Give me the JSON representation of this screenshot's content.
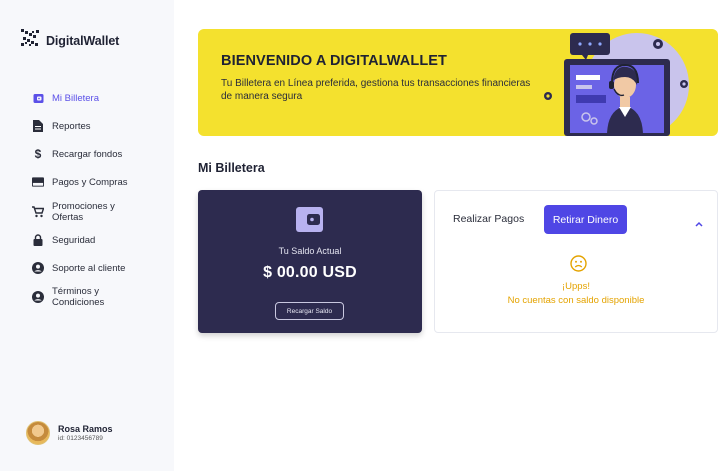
{
  "brand": {
    "name": "DigitalWallet"
  },
  "sidebar": {
    "items": [
      {
        "label": "Mi Billetera",
        "icon": "wallet-icon",
        "active": true
      },
      {
        "label": "Reportes",
        "icon": "report-icon"
      },
      {
        "label": "Recargar fondos",
        "icon": "dollar-icon"
      },
      {
        "label": "Pagos y Compras",
        "icon": "credit-card-icon"
      },
      {
        "label": "Promociones y Ofertas",
        "icon": "cart-icon"
      },
      {
        "label": "Seguridad",
        "icon": "lock-icon"
      },
      {
        "label": "Soporte al cliente",
        "icon": "account-icon"
      },
      {
        "label": "Términos y Condiciones",
        "icon": "account-icon"
      }
    ]
  },
  "user": {
    "name": "Rosa Ramos",
    "id": "id: 0123456789"
  },
  "banner": {
    "title": "BIENVENIDO A DIGITALWALLET",
    "subtitle": "Tu Billetera en Línea preferida, gestiona tus transacciones financieras de manera segura"
  },
  "section": {
    "title": "Mi Billetera"
  },
  "balance": {
    "label": "Tu Saldo Actual",
    "value": "$ 00.00 USD",
    "button": "Recargar Saldo"
  },
  "actions": {
    "tab_pay": "Realizar Pagos",
    "tab_withdraw": "Retirar Dinero",
    "empty_title": "¡Upps!",
    "empty_message": "No cuentas con saldo disponible"
  },
  "colors": {
    "accent": "#4f46e5",
    "banner": "#f4e12e",
    "card": "#2d2b4f",
    "warning": "#e4a300"
  }
}
